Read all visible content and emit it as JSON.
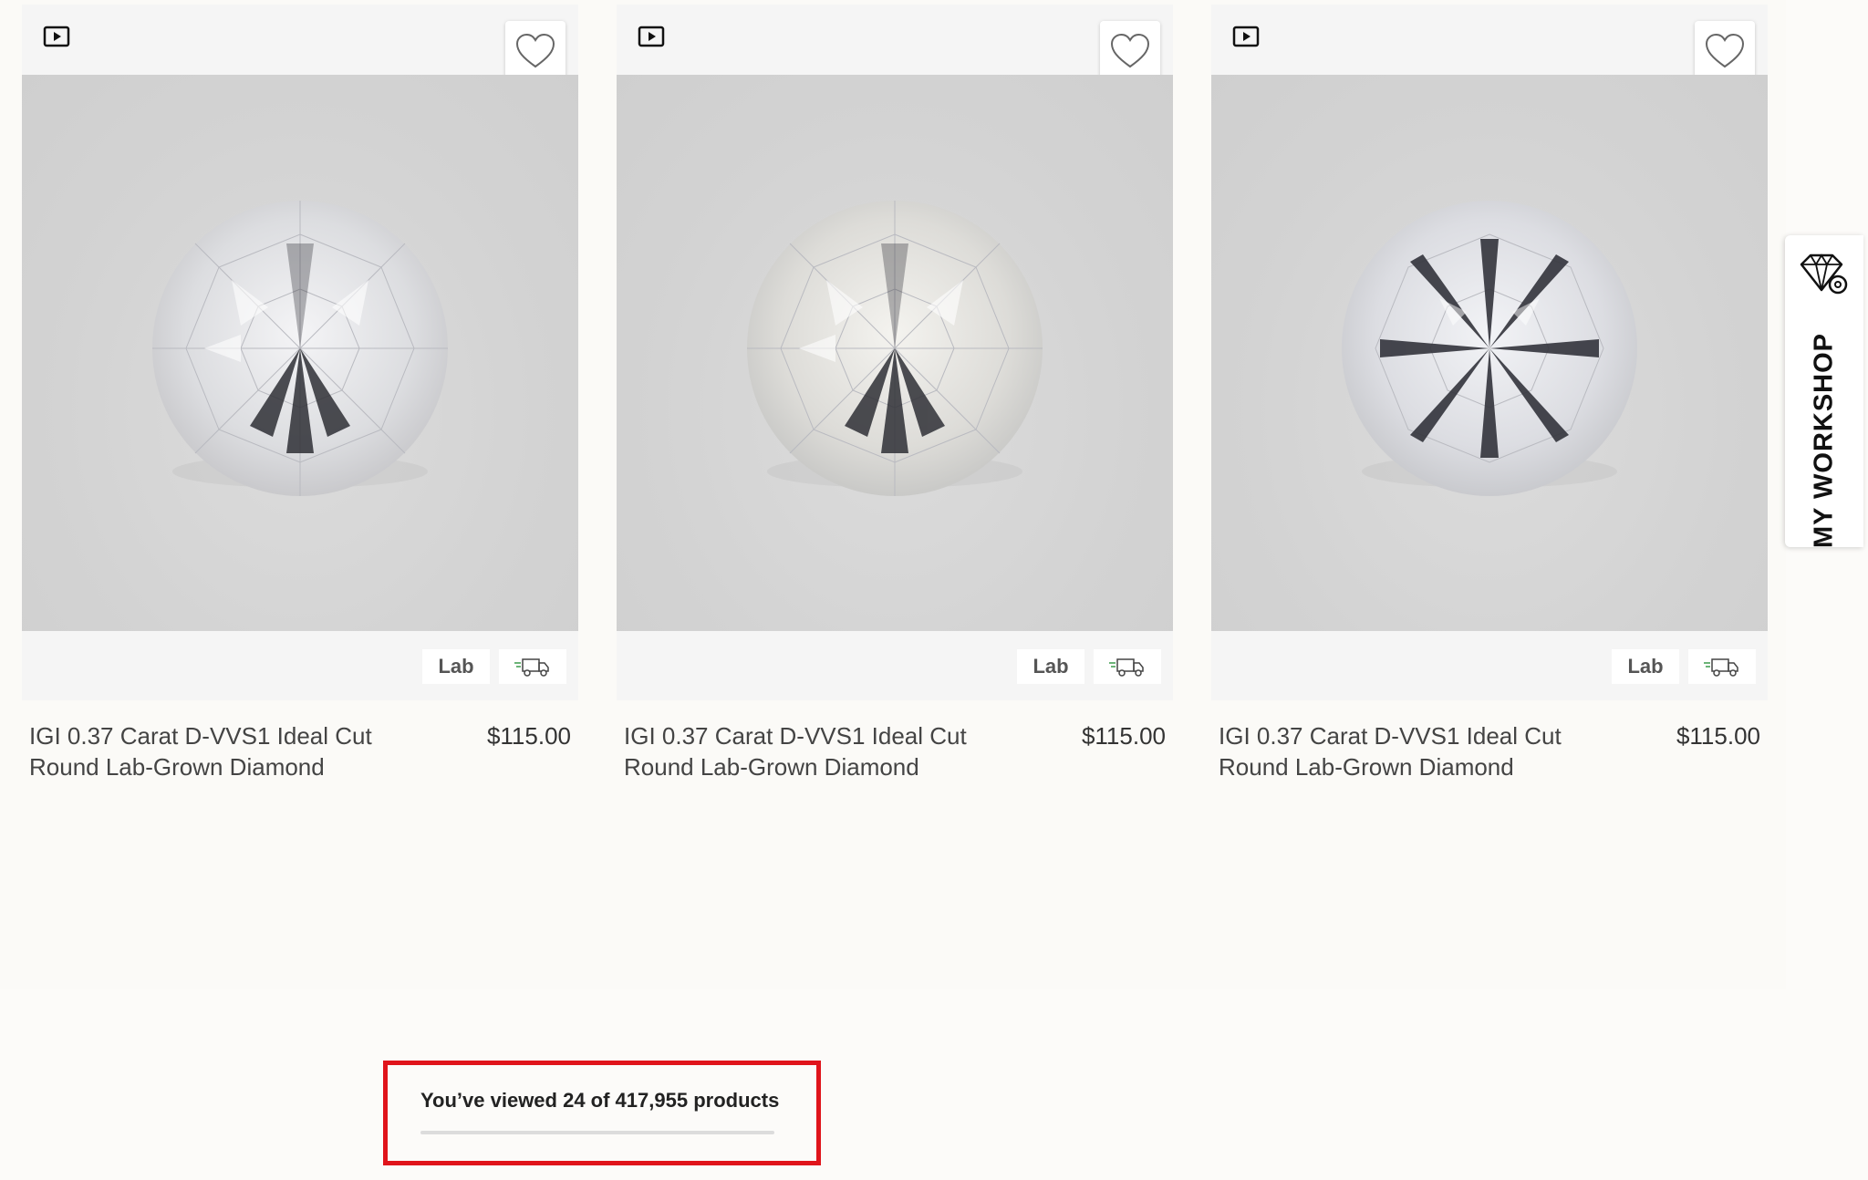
{
  "products": [
    {
      "title": "IGI 0.37 Carat D-VVS1 Ideal Cut Round Lab-Grown Diamond",
      "price": "$115.00",
      "badge": "Lab"
    },
    {
      "title": "IGI 0.37 Carat D-VVS1 Ideal Cut Round Lab-Grown Diamond",
      "price": "$115.00",
      "badge": "Lab"
    },
    {
      "title": "IGI 0.37 Carat D-VVS1 Ideal Cut Round Lab-Grown Diamond",
      "price": "$115.00",
      "badge": "Lab"
    }
  ],
  "workshop": {
    "label": "MY WORKSHOP"
  },
  "pagination": {
    "viewed_text": "You’ve viewed 24 of 417,955 products",
    "viewed": 24,
    "total": 417955
  },
  "colors": {
    "highlight_border": "#e0141b",
    "page_bg": "#fbfaf7",
    "image_bg": "#d3d3d3"
  }
}
